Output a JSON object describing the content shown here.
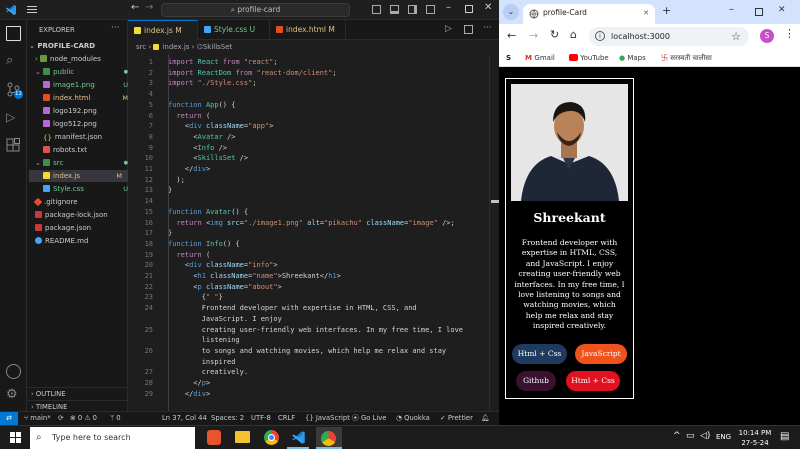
{
  "vscode": {
    "search_text": "profile-card",
    "explorer": {
      "title": "EXPLORER",
      "root": "PROFILE-CARD",
      "tree": [
        {
          "label": "node_modules",
          "mark": ""
        },
        {
          "label": "public",
          "mark": "●"
        },
        {
          "label": "image1.png",
          "mark": "U"
        },
        {
          "label": "index.html",
          "mark": "M"
        },
        {
          "label": "logo192.png",
          "mark": ""
        },
        {
          "label": "logo512.png",
          "mark": ""
        },
        {
          "label": "manifest.json",
          "mark": ""
        },
        {
          "label": "robots.txt",
          "mark": ""
        },
        {
          "label": "src",
          "mark": "●"
        },
        {
          "label": "index.js",
          "mark": "M"
        },
        {
          "label": "Style.css",
          "mark": "U"
        },
        {
          "label": ".gitignore",
          "mark": ""
        },
        {
          "label": "package-lock.json",
          "mark": ""
        },
        {
          "label": "package.json",
          "mark": ""
        },
        {
          "label": "README.md",
          "mark": ""
        }
      ],
      "outline": "OUTLINE",
      "timeline": "TIMELINE"
    },
    "tabs": [
      {
        "label": "index.js",
        "mark": "M"
      },
      {
        "label": "Style.css",
        "mark": "U"
      },
      {
        "label": "index.html",
        "mark": "M"
      }
    ],
    "breadcrumb": {
      "a": "src",
      "b": "index.js",
      "c": "SkillsSet"
    },
    "lines": [
      {
        "n": "1",
        "t": "import React from \"react\";"
      },
      {
        "n": "2",
        "t": "import ReactDom from \"react-dom/client\";"
      },
      {
        "n": "3",
        "t": "import \"./Style.css\";"
      },
      {
        "n": "4",
        "t": ""
      },
      {
        "n": "5",
        "t": "function App() {"
      },
      {
        "n": "6",
        "t": "  return ("
      },
      {
        "n": "7",
        "t": "    <div className=\"app\">"
      },
      {
        "n": "8",
        "t": "      <Avatar />"
      },
      {
        "n": "9",
        "t": "      <Info />"
      },
      {
        "n": "10",
        "t": "      <SkillsSet />"
      },
      {
        "n": "11",
        "t": "    </div>"
      },
      {
        "n": "12",
        "t": "  );"
      },
      {
        "n": "13",
        "t": "}"
      },
      {
        "n": "14",
        "t": ""
      },
      {
        "n": "15",
        "t": "function Avatar() {"
      },
      {
        "n": "16",
        "t": "  return <img src=\"./image1.png\" alt=\"pikachu\" className=\"image\" />;"
      },
      {
        "n": "17",
        "t": "}"
      },
      {
        "n": "18",
        "t": "function Info() {"
      },
      {
        "n": "19",
        "t": "  return ("
      },
      {
        "n": "20",
        "t": "    <div className=\"info\">"
      },
      {
        "n": "21",
        "t": "      <h1 className=\"name\">Shreekant</h1>"
      },
      {
        "n": "22",
        "t": "      <p className=\"about\">"
      },
      {
        "n": "23",
        "t": "        {\" \"}"
      },
      {
        "n": "24",
        "t": "        Frontend developer with expertise in HTML, CSS, and"
      },
      {
        "n": "",
        "t": "        JavaScript. I enjoy"
      },
      {
        "n": "25",
        "t": "        creating user-friendly web interfaces. In my free time, I love"
      },
      {
        "n": "",
        "t": "        listening"
      },
      {
        "n": "26",
        "t": "        to songs and watching movies, which help me relax and stay"
      },
      {
        "n": "",
        "t": "        inspired"
      },
      {
        "n": "27",
        "t": "        creatively."
      },
      {
        "n": "28",
        "t": "      </p>"
      },
      {
        "n": "29",
        "t": "    </div>"
      }
    ],
    "status": {
      "branch": "main*",
      "problems": "⊗ 0 ⚠ 0",
      "ports": "0",
      "position": "Ln 37, Col 44",
      "spaces": "Spaces: 2",
      "encoding": "UTF-8",
      "eol": "CRLF",
      "language": "JavaScript",
      "golive": "Go Live",
      "quokka": "Quokka",
      "prettier": "Prettier"
    }
  },
  "browser": {
    "tab_title": "profile-Card",
    "url": "localhost:3000",
    "profile_initial": "S",
    "bookmarks": [
      "Gmail",
      "YouTube",
      "Maps",
      "सरस्वती चालीसा"
    ],
    "card": {
      "name": "Shreekant",
      "about": "Frontend developer with expertise in HTML, CSS, and JavaScript. I enjoy creating user-friendly web interfaces. In my free time, I love listening to songs and watching movies, which help me relax and stay inspired creatively.",
      "skills": [
        {
          "label": "Html + Css",
          "color": "#1f3a5f"
        },
        {
          "label": "JavaScript",
          "color": "#f0521c"
        },
        {
          "label": "Github",
          "color": "#3a1230"
        },
        {
          "label": "Html + Css",
          "color": "#e0121f"
        }
      ]
    }
  },
  "taskbar": {
    "search_placeholder": "Type here to search",
    "lang": "ENG",
    "time": "10:14 PM",
    "date": "27-5-24"
  }
}
